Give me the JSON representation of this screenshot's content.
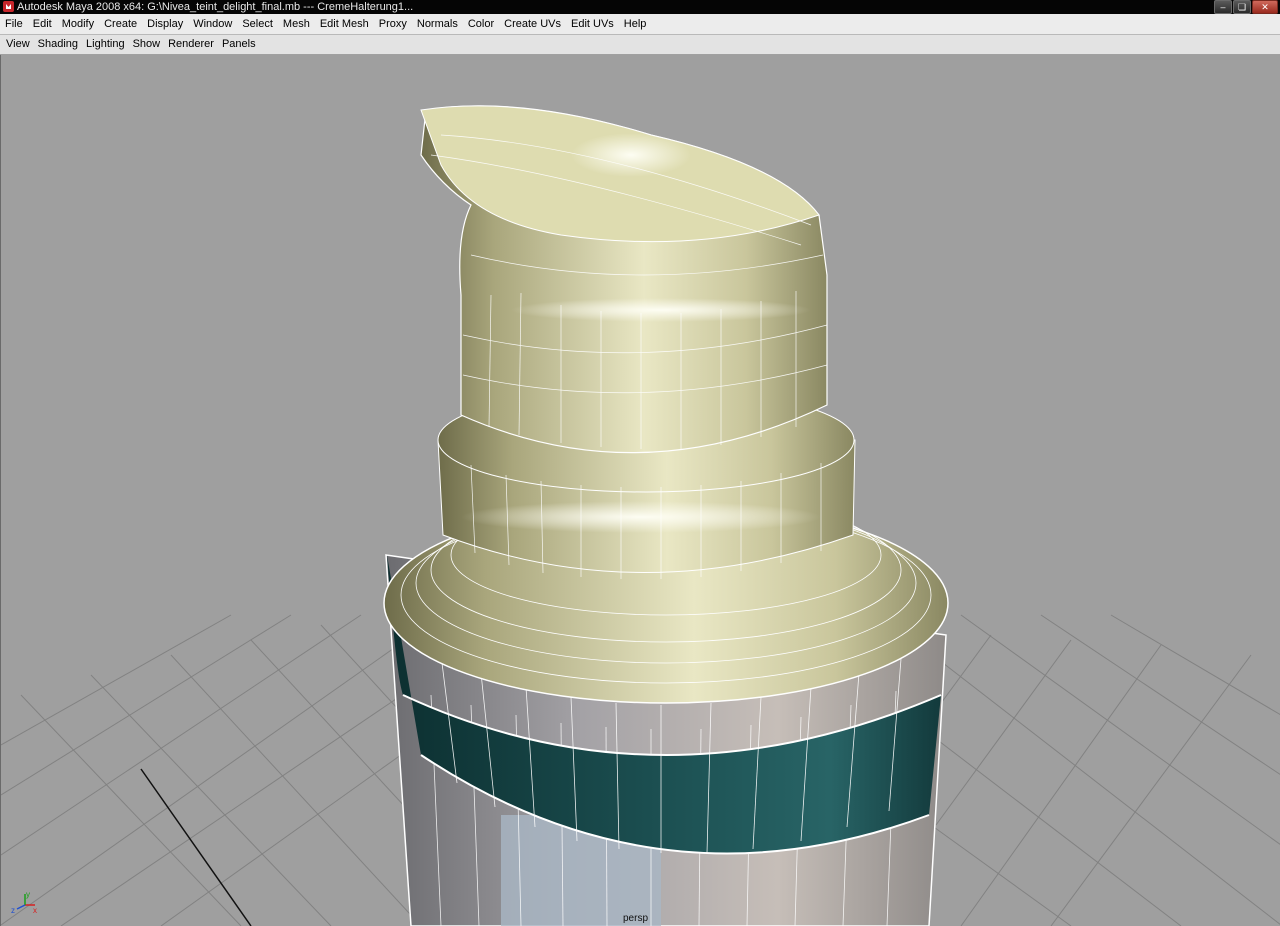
{
  "window": {
    "title": "Autodesk Maya 2008 x64: G:\\Nivea_teint_delight_final.mb   ---   CremeHalterung1...",
    "controls": [
      "minimize-icon",
      "restore-icon",
      "close-icon"
    ]
  },
  "menu": {
    "items": [
      "File",
      "Edit",
      "Modify",
      "Create",
      "Display",
      "Window",
      "Select",
      "Mesh",
      "Edit Mesh",
      "Proxy",
      "Normals",
      "Color",
      "Create UVs",
      "Edit UVs",
      "Help"
    ]
  },
  "panel_menu": {
    "items": [
      "View",
      "Shading",
      "Lighting",
      "Show",
      "Renderer",
      "Panels"
    ]
  },
  "viewport": {
    "camera": "persp",
    "background": "#9f9f9f",
    "axis": {
      "x": "x",
      "y": "y",
      "z": "z"
    },
    "colors": {
      "cap": "#d8d6a8",
      "band": "#1f5a5a",
      "body": "#b6b2b0",
      "wire": "#ffffff",
      "grid": "#7c7c7c"
    }
  }
}
